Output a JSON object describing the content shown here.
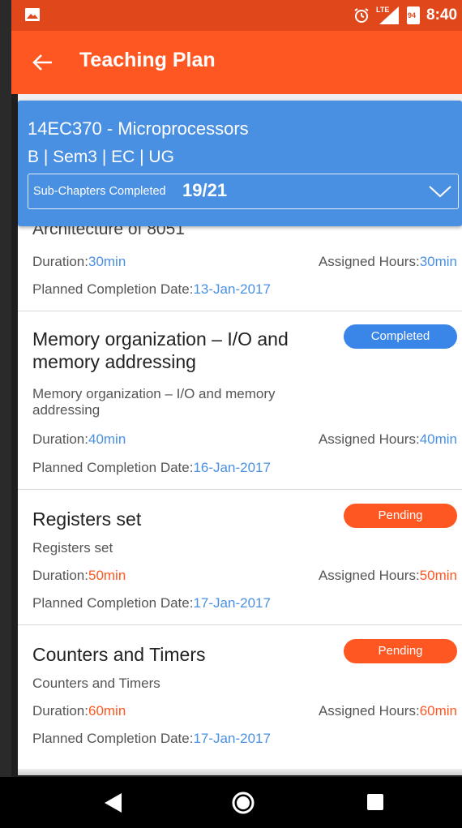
{
  "status_bar": {
    "time": "8:40",
    "lte_label": "LTE",
    "battery_level": "94"
  },
  "app_bar": {
    "title": "Teaching Plan"
  },
  "course": {
    "title": "14EC370 - Microprocessors",
    "subtitle": "B | Sem3 | EC | UG",
    "progress_label": "Sub-Chapters Completed",
    "progress_count": "19/21"
  },
  "items": [
    {
      "title": "Architecture of 8051",
      "duration_label": "Duration:",
      "duration": "30min",
      "assigned_label": "Assigned Hours:",
      "assigned": "30min",
      "planned_label": "Planned Completion Date:",
      "planned_date": "13-Jan-2017"
    },
    {
      "title": "Memory organization – I/O and memory addressing",
      "status": "Completed",
      "description": "Memory organization – I/O and memory addressing",
      "duration_label": "Duration:",
      "duration": "40min",
      "assigned_label": "Assigned Hours:",
      "assigned": "40min",
      "planned_label": "Planned Completion Date:",
      "planned_date": "16-Jan-2017"
    },
    {
      "title": "Registers set",
      "status": "Pending",
      "description": "Registers set",
      "duration_label": "Duration:",
      "duration": "50min",
      "assigned_label": "Assigned Hours:",
      "assigned": "50min",
      "planned_label": "Planned Completion Date:",
      "planned_date": "17-Jan-2017"
    },
    {
      "title": "Counters and Timers",
      "status": "Pending",
      "description": "Counters and Timers",
      "duration_label": "Duration:",
      "duration": "60min",
      "assigned_label": "Assigned Hours:",
      "assigned": "60min",
      "planned_label": "Planned Completion Date:",
      "planned_date": "17-Jan-2017"
    }
  ],
  "icons": {
    "status_left": "image-icon",
    "alarm": "alarm-icon",
    "signal": "signal-icon",
    "battery": "battery-icon",
    "back": "back-arrow-icon",
    "chevron": "chevron-down-icon",
    "nav_back": "nav-back-icon",
    "nav_home": "nav-home-icon",
    "nav_recent": "nav-recent-icon"
  },
  "colors": {
    "primary": "#ff5722",
    "status_bar": "#e0471b",
    "accent_blue": "#4a90e2",
    "completed": "#3a86e8",
    "pending": "#ff5722"
  }
}
